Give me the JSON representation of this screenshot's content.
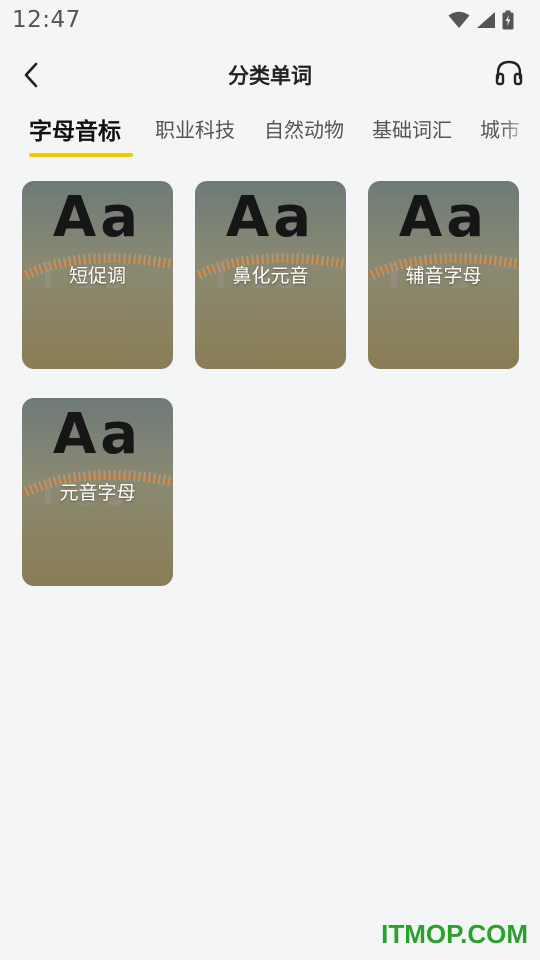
{
  "status_bar": {
    "time": "12:47"
  },
  "header": {
    "title": "分类单词"
  },
  "tabs": [
    {
      "label": "字母音标",
      "active": true
    },
    {
      "label": "职业科技",
      "active": false
    },
    {
      "label": "自然动物",
      "active": false
    },
    {
      "label": "基础词汇",
      "active": false
    },
    {
      "label": "城市",
      "active": false
    }
  ],
  "cards": [
    {
      "cover_text": "Aa",
      "label": "短促调"
    },
    {
      "cover_text": "Aa",
      "label": "鼻化元音"
    },
    {
      "cover_text": "Aa",
      "label": "辅音字母"
    },
    {
      "cover_text": "Aa",
      "label": "元音字母"
    }
  ],
  "watermark": "ITMOP.COM",
  "colors": {
    "accent": "#f7c600",
    "background": "#f4f5f7",
    "watermark": "#2aa12a"
  },
  "icons": {
    "back": "chevron-left-icon",
    "audio": "headphones-icon"
  }
}
